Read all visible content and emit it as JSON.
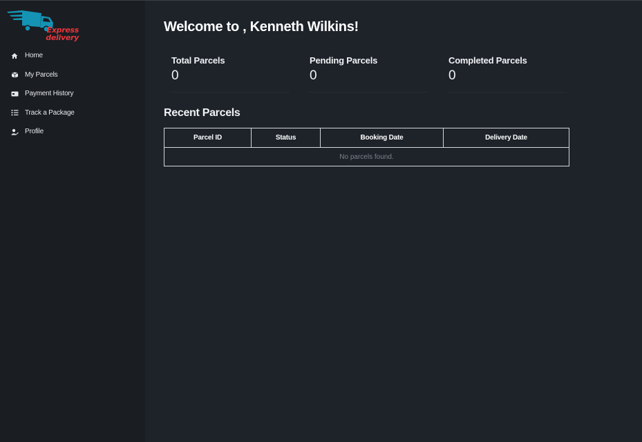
{
  "brand": {
    "line1": "Express",
    "line2": "delivery",
    "logo_color": "#1493b5",
    "text_color": "#e8363b"
  },
  "sidebar": {
    "items": [
      {
        "label": "Home",
        "icon": "home-icon"
      },
      {
        "label": "My Parcels",
        "icon": "parcels-icon"
      },
      {
        "label": "Payment History",
        "icon": "payment-icon"
      },
      {
        "label": "Track a Package",
        "icon": "track-list-icon"
      },
      {
        "label": "Profile",
        "icon": "user-edit-icon"
      }
    ]
  },
  "main": {
    "welcome": "Welcome to , Kenneth Wilkins!",
    "stats": [
      {
        "label": "Total Parcels",
        "value": "0"
      },
      {
        "label": "Pending Parcels",
        "value": "0"
      },
      {
        "label": "Completed Parcels",
        "value": "0"
      }
    ],
    "recent_title": "Recent Parcels",
    "table": {
      "columns": [
        "Parcel ID",
        "Status",
        "Booking Date",
        "Delivery Date"
      ],
      "empty_message": "No parcels found."
    }
  },
  "colors": {
    "background": "#1e232a",
    "sidebar_bg": "#1a1d22"
  }
}
